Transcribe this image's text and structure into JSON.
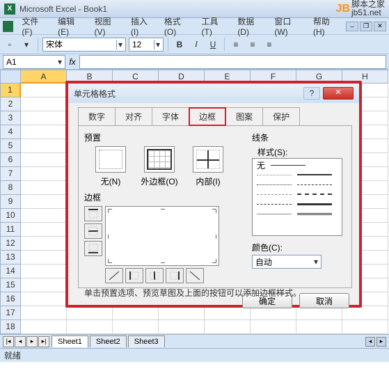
{
  "window": {
    "title": "Microsoft Excel - Book1"
  },
  "watermark": {
    "logo_letters": "JB",
    "line1": "脚本之家",
    "line2": "jb51.net"
  },
  "menus": [
    "文件(F)",
    "编辑(E)",
    "视图(V)",
    "插入(I)",
    "格式(O)",
    "工具(T)",
    "数据(D)",
    "窗口(W)",
    "帮助(H)"
  ],
  "toolbar": {
    "font_name": "宋体",
    "font_size": "12",
    "bold": "B",
    "italic": "I",
    "underline": "U"
  },
  "namebox": "A1",
  "columns": [
    "A",
    "B",
    "C",
    "D",
    "E",
    "F",
    "G",
    "H"
  ],
  "row_count": 18,
  "sheets": [
    "Sheet1",
    "Sheet2",
    "Sheet3"
  ],
  "status": "就绪",
  "dialog": {
    "title": "单元格格式",
    "tabs": [
      "数字",
      "对齐",
      "字体",
      "边框",
      "图案",
      "保护"
    ],
    "active_tab_index": 3,
    "preset_label": "预置",
    "presets": [
      {
        "label": "无(N)"
      },
      {
        "label": "外边框(O)"
      },
      {
        "label": "内部(I)"
      }
    ],
    "border_label": "边框",
    "line_label": "线条",
    "style_label": "样式(S):",
    "style_none": "无",
    "color_label": "颜色(C):",
    "color_value": "自动",
    "hint": "单击预置选项、预览草图及上面的按钮可以添加边框样式。",
    "ok": "确定",
    "cancel": "取消"
  }
}
